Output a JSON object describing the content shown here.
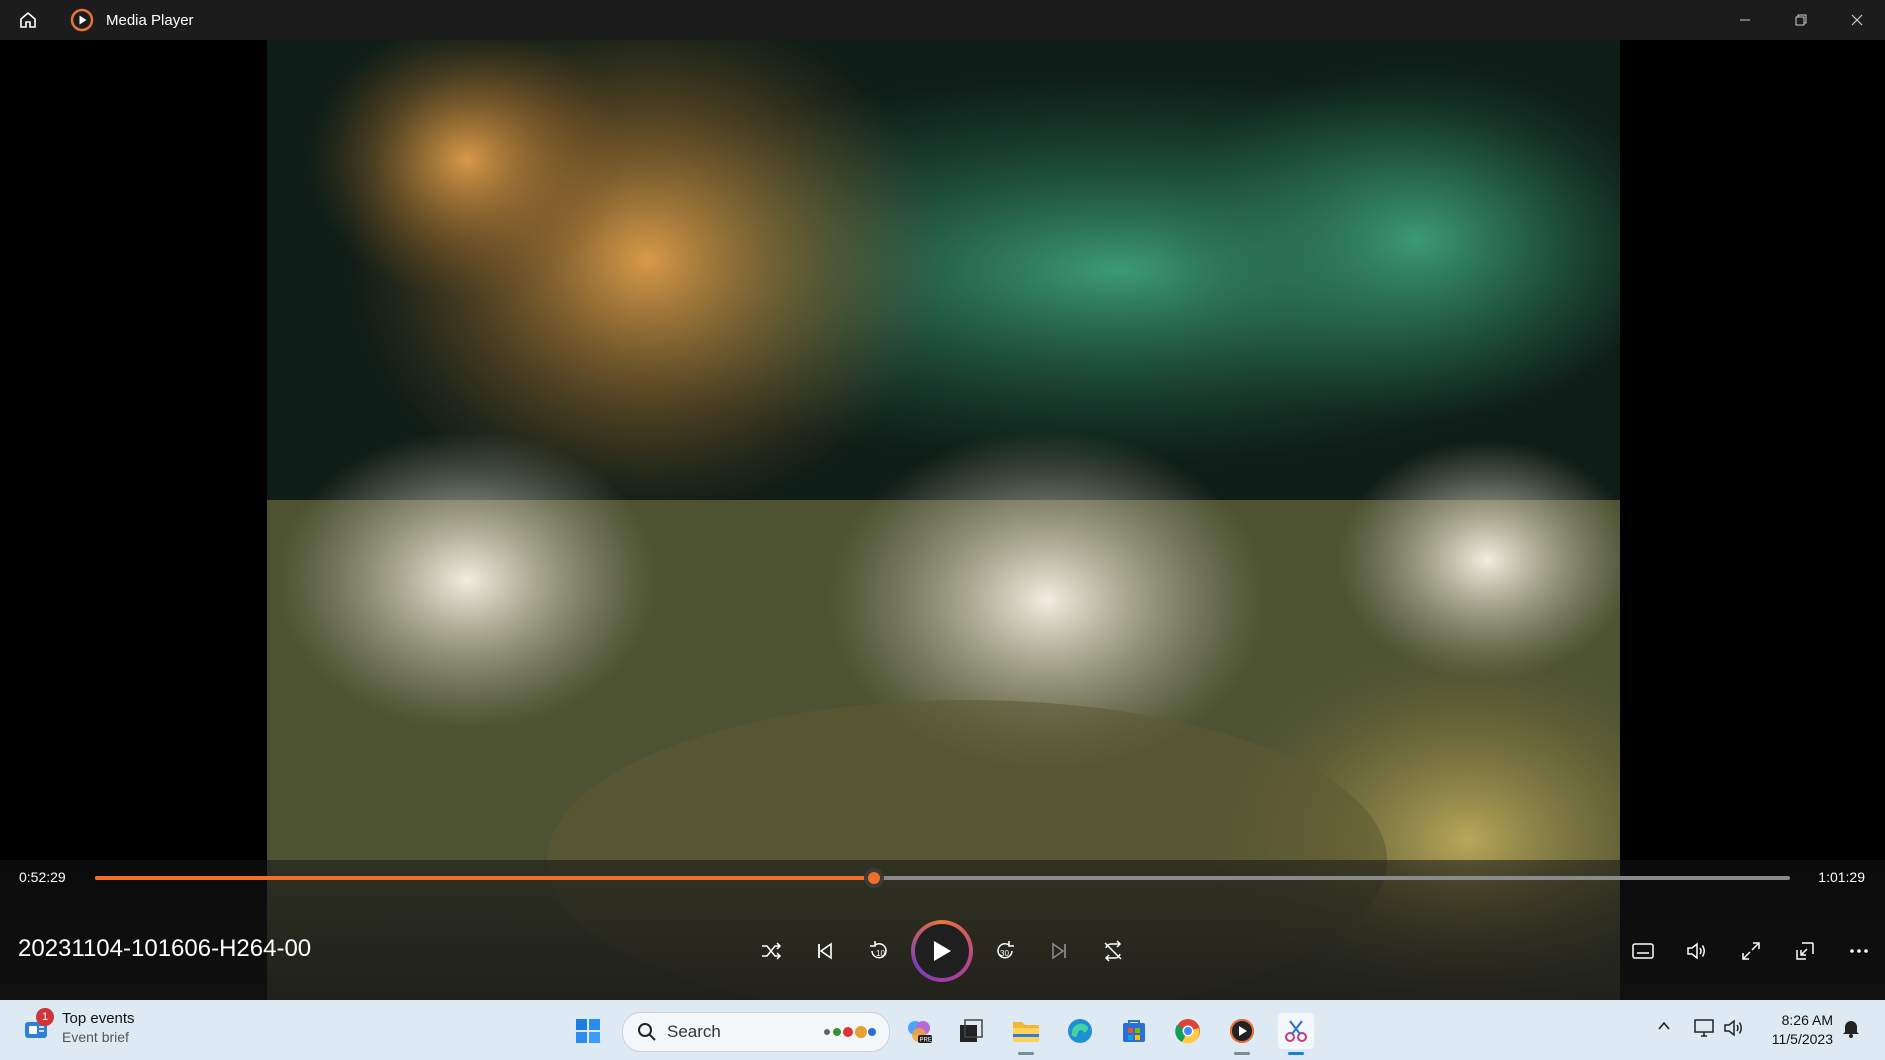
{
  "titlebar": {
    "title": "Media Player",
    "home_icon": "home-icon",
    "app_icon": "media-player-icon",
    "window_controls": [
      "minimize-icon",
      "restore-icon",
      "close-icon"
    ]
  },
  "player": {
    "current_time": "0:52:29",
    "total_time": "1:01:29",
    "progress": 0.4597,
    "file_title": "20231104-101606-H264-00",
    "accent_color": "#f0702a",
    "controls": [
      "shuffle-icon",
      "previous-icon",
      "rewind-10-icon",
      "play-icon",
      "forward-30-icon",
      "next-icon",
      "repeat-off-icon"
    ],
    "right_controls": [
      "captions-icon",
      "volume-icon",
      "fullscreen-icon",
      "mini-player-icon",
      "more-options-icon"
    ]
  },
  "taskbar": {
    "widget_title": "Top events",
    "widget_subtitle": "Event brief",
    "widget_badge": "1",
    "search_placeholder": "Search",
    "pinned_apps": [
      "windows-start-icon",
      "copilot-icon",
      "task-view-icon",
      "file-explorer-icon",
      "edge-icon",
      "store-icon",
      "chrome-icon",
      "media-player-icon",
      "snipping-tool-icon"
    ],
    "tray_icons": [
      "chevron-up-icon",
      "network-icon",
      "speaker-icon",
      "notification-bell-icon"
    ],
    "time": "8:26 AM",
    "date": "11/5/2023"
  }
}
